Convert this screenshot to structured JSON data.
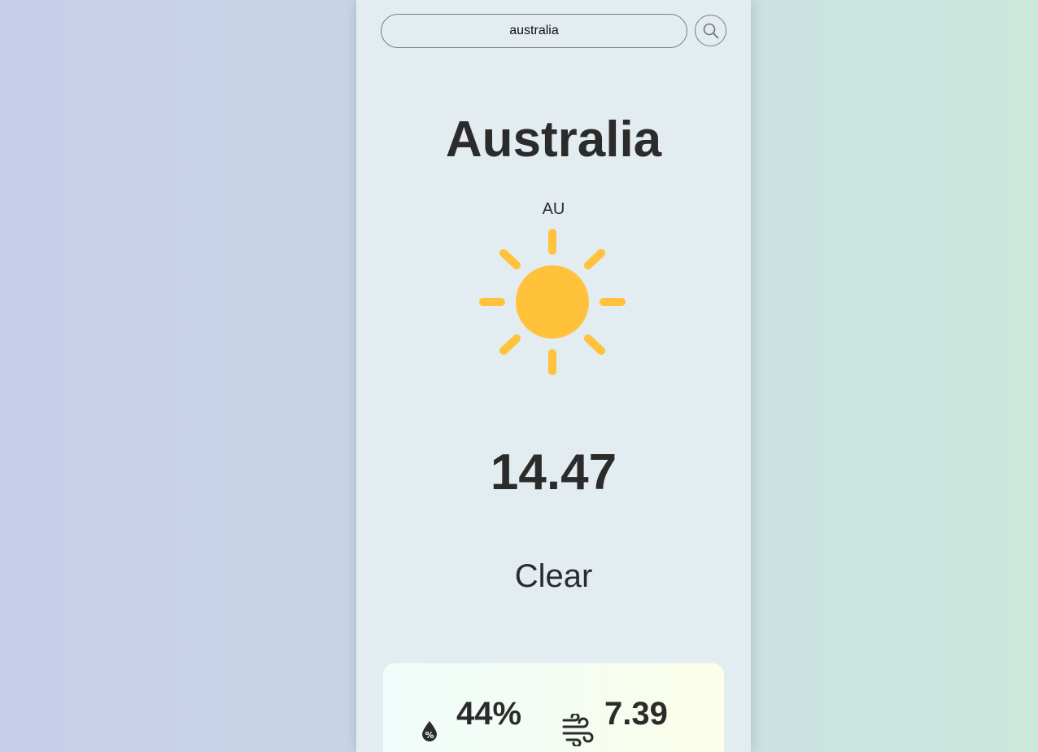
{
  "search": {
    "value": "australia",
    "button_icon": "search-icon"
  },
  "weather": {
    "city": "Australia",
    "country": "AU",
    "condition_icon": "sun-icon",
    "temperature": "14.47",
    "description": "Clear"
  },
  "details": {
    "humidity_icon": "humidity-drop-icon",
    "humidity": "44%",
    "wind_icon": "wind-icon",
    "wind_speed": "7.39"
  },
  "colors": {
    "sun": "#ffc23a",
    "text": "#2b2b2b",
    "card_bg": "#e3ecf1"
  }
}
